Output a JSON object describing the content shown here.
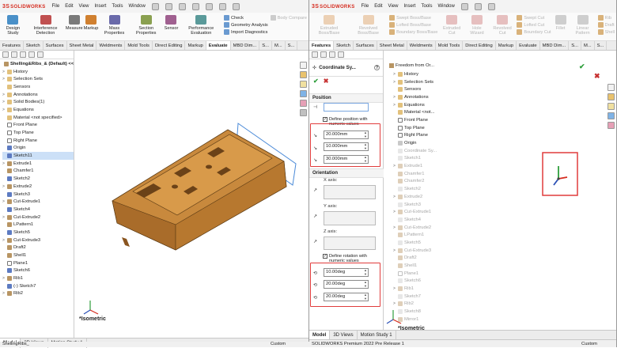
{
  "app": {
    "logo_prefix": "3S",
    "logo_text": "SOLIDWORKS",
    "menus": [
      "File",
      "Edit",
      "View",
      "Insert",
      "Tools",
      "Window"
    ]
  },
  "left": {
    "ribbon": [
      {
        "label": "Design Study",
        "color": "#4a90c8"
      },
      {
        "label": "Interference Detection",
        "color": "#c05050"
      },
      {
        "label": "Measure",
        "color": "#7a7a7a"
      },
      {
        "label": "Markup",
        "color": "#d08030"
      },
      {
        "label": "Mass Properties",
        "color": "#6a6aaa"
      },
      {
        "label": "Section Properties",
        "color": "#8aa050"
      },
      {
        "label": "Sensor",
        "color": "#a06090"
      },
      {
        "label": "Performance Evaluation",
        "color": "#5a9a9a"
      }
    ],
    "ribbon_small": [
      "Check",
      "Geometry Analysis",
      "Import Diagnostics"
    ],
    "ribbon_small_dim": [
      "Body Compare"
    ],
    "tabs": [
      "Features",
      "Sketch",
      "Surfaces",
      "Sheet Metal",
      "Weldments",
      "Mold Tools",
      "Direct Editing",
      "Markup",
      "Evaluate",
      "MBD Dim...",
      "S...",
      "M...",
      "S..."
    ],
    "active_tab": "Evaluate",
    "tree": [
      {
        "label": "Shelling&Ribs_& (Default) <<Default>_D",
        "icon": "x",
        "exp": "",
        "cls": "root"
      },
      {
        "label": "History",
        "icon": "f",
        "exp": ">"
      },
      {
        "label": "Selection Sets",
        "icon": "f",
        "exp": ">"
      },
      {
        "label": "Sensors",
        "icon": "f",
        "exp": ""
      },
      {
        "label": "Annotations",
        "icon": "f",
        "exp": ">"
      },
      {
        "label": "Solid Bodies(1)",
        "icon": "f",
        "exp": ">"
      },
      {
        "label": "Equations",
        "icon": "f",
        "exp": ">"
      },
      {
        "label": "Material <not specified>",
        "icon": "f",
        "exp": ""
      },
      {
        "label": "Front Plane",
        "icon": "p",
        "exp": ""
      },
      {
        "label": "Top Plane",
        "icon": "p",
        "exp": ""
      },
      {
        "label": "Right Plane",
        "icon": "p",
        "exp": ""
      },
      {
        "label": "Origin",
        "icon": "s",
        "exp": ""
      },
      {
        "label": "Sketch11",
        "icon": "s",
        "exp": "",
        "cls": "hl"
      },
      {
        "label": "Extrude1",
        "icon": "x",
        "exp": ">"
      },
      {
        "label": "Chamfer1",
        "icon": "x",
        "exp": ""
      },
      {
        "label": "Sketch2",
        "icon": "s",
        "exp": ""
      },
      {
        "label": "Extrude2",
        "icon": "x",
        "exp": ">"
      },
      {
        "label": "Sketch3",
        "icon": "s",
        "exp": ""
      },
      {
        "label": "Cut-Extrude1",
        "icon": "x",
        "exp": ">"
      },
      {
        "label": "Sketch4",
        "icon": "s",
        "exp": ""
      },
      {
        "label": "Cut-Extrude2",
        "icon": "x",
        "exp": ">"
      },
      {
        "label": "LPattern1",
        "icon": "x",
        "exp": ""
      },
      {
        "label": "Sketch5",
        "icon": "s",
        "exp": ""
      },
      {
        "label": "Cut-Extrude3",
        "icon": "x",
        "exp": ">"
      },
      {
        "label": "Draft2",
        "icon": "x",
        "exp": ""
      },
      {
        "label": "Shell1",
        "icon": "x",
        "exp": ""
      },
      {
        "label": "Plane1",
        "icon": "p",
        "exp": ""
      },
      {
        "label": "Sketch6",
        "icon": "s",
        "exp": ""
      },
      {
        "label": "Rib1",
        "icon": "x",
        "exp": ">"
      },
      {
        "label": "(-) Sketch7",
        "icon": "s",
        "exp": ""
      },
      {
        "label": "Rib2",
        "icon": "x",
        "exp": ">"
      }
    ],
    "view_label": "*Isometric",
    "bottom_tabs": [
      "Model",
      "3D Views",
      "Motion Study 1"
    ],
    "bottom_active": "Model",
    "status_left": "ShellingRibs_",
    "status_right": "Custom"
  },
  "right": {
    "menus": [
      "File",
      "Edit",
      "View",
      "Insert",
      "Tools",
      "Window"
    ],
    "ribbon": [
      {
        "label": "Extruded Boss/Base",
        "color": "#d08030"
      },
      {
        "label": "Revolved Boss/Base",
        "color": "#d08030"
      },
      {
        "label": "Extruded Cut",
        "color": "#c05050"
      },
      {
        "label": "Hole Wizard",
        "color": "#c05050"
      },
      {
        "label": "Revolved Cut",
        "color": "#c05050"
      },
      {
        "label": "Fillet",
        "color": "#7a7a7a"
      },
      {
        "label": "Linear Pattern",
        "color": "#7a7a7a"
      }
    ],
    "ribbon_small_a": [
      "Swept Boss/Base",
      "Lofted Boss/Base",
      "Boundary Boss/Base"
    ],
    "ribbon_small_b": [
      "Swept Cut",
      "Lofted Cut",
      "Boundary Cut"
    ],
    "ribbon_small_c": [
      "Rib",
      "Draft",
      "Shell"
    ],
    "tabs": [
      "Features",
      "Sketch",
      "Surfaces",
      "Sheet Metal",
      "Weldments",
      "Mold Tools",
      "Direct Editing",
      "Markup",
      "Evaluate",
      "MBD Dim...",
      "S...",
      "M...",
      "S..."
    ],
    "active_tab": "Features",
    "coord": {
      "title": "Coordinate Sy...",
      "help": "?",
      "ok": "✔",
      "cancel": "✖",
      "position_section": "Position",
      "define_position": "Define position with numeric values",
      "x": "20.000mm",
      "y": "10.000mm",
      "z": "30.000mm",
      "orientation_section": "Orientation",
      "x_axis": "X axis:",
      "y_axis": "Y axis:",
      "z_axis": "Z axis:",
      "define_rotation": "Define rotation with numeric values",
      "rx": "10.00deg",
      "ry": "20.00deg",
      "rz": "20.00deg"
    },
    "tree_root": "Freedom from Or...",
    "tree": [
      {
        "label": "History",
        "icon": "f",
        "exp": ">"
      },
      {
        "label": "Selection Sets",
        "icon": "f",
        "exp": ">"
      },
      {
        "label": "Sensors",
        "icon": "f",
        "exp": ""
      },
      {
        "label": "Annotations",
        "icon": "f",
        "exp": ">"
      },
      {
        "label": "Equations",
        "icon": "f",
        "exp": ">"
      },
      {
        "label": "Material <not...",
        "icon": "f",
        "exp": ""
      },
      {
        "label": "Front Plane",
        "icon": "p",
        "exp": ""
      },
      {
        "label": "Top Plane",
        "icon": "p",
        "exp": ""
      },
      {
        "label": "Right Plane",
        "icon": "p",
        "exp": ""
      },
      {
        "label": "Origin",
        "icon": "s",
        "exp": ""
      },
      {
        "label": "Coordinate Sy...",
        "icon": "s",
        "exp": "",
        "cls": "gray"
      },
      {
        "label": "Sketch1",
        "icon": "s",
        "exp": "",
        "cls": "gray"
      },
      {
        "label": "Extrude1",
        "icon": "x",
        "exp": ">",
        "cls": "gray"
      },
      {
        "label": "Chamfer1",
        "icon": "x",
        "exp": "",
        "cls": "gray"
      },
      {
        "label": "Chamfer2",
        "icon": "x",
        "exp": "",
        "cls": "gray"
      },
      {
        "label": "Sketch2",
        "icon": "s",
        "exp": "",
        "cls": "gray"
      },
      {
        "label": "Extrude2",
        "icon": "x",
        "exp": ">",
        "cls": "gray"
      },
      {
        "label": "Sketch3",
        "icon": "s",
        "exp": "",
        "cls": "gray"
      },
      {
        "label": "Cut-Extrude1",
        "icon": "x",
        "exp": ">",
        "cls": "gray"
      },
      {
        "label": "Sketch4",
        "icon": "s",
        "exp": "",
        "cls": "gray"
      },
      {
        "label": "Cut-Extrude2",
        "icon": "x",
        "exp": ">",
        "cls": "gray"
      },
      {
        "label": "LPattern1",
        "icon": "x",
        "exp": "",
        "cls": "gray"
      },
      {
        "label": "Sketch5",
        "icon": "s",
        "exp": "",
        "cls": "gray"
      },
      {
        "label": "Cut-Extrude3",
        "icon": "x",
        "exp": ">",
        "cls": "gray"
      },
      {
        "label": "Draft2",
        "icon": "x",
        "exp": "",
        "cls": "gray"
      },
      {
        "label": "Shell1",
        "icon": "x",
        "exp": "",
        "cls": "gray"
      },
      {
        "label": "Plane1",
        "icon": "p",
        "exp": "",
        "cls": "gray"
      },
      {
        "label": "Sketch6",
        "icon": "s",
        "exp": "",
        "cls": "gray"
      },
      {
        "label": "Rib1",
        "icon": "x",
        "exp": ">",
        "cls": "gray"
      },
      {
        "label": "Sketch7",
        "icon": "s",
        "exp": "",
        "cls": "gray"
      },
      {
        "label": "Rib2",
        "icon": "x",
        "exp": ">",
        "cls": "gray"
      },
      {
        "label": "Sketch8",
        "icon": "s",
        "exp": "",
        "cls": "gray"
      },
      {
        "label": "Mirror1",
        "icon": "x",
        "exp": "",
        "cls": "gray"
      }
    ],
    "view_label": "*Isometric",
    "bottom_tabs": [
      "Model",
      "3D Views",
      "Motion Study 1"
    ],
    "bottom_active": "Model",
    "status_left": "SOLIDWORKS Premium 2022 Pre Release 1",
    "status_right": "Custom"
  },
  "colors": {
    "accent": "#d52b1e",
    "part": "#c8893d",
    "highlight": "#e03c3c"
  }
}
